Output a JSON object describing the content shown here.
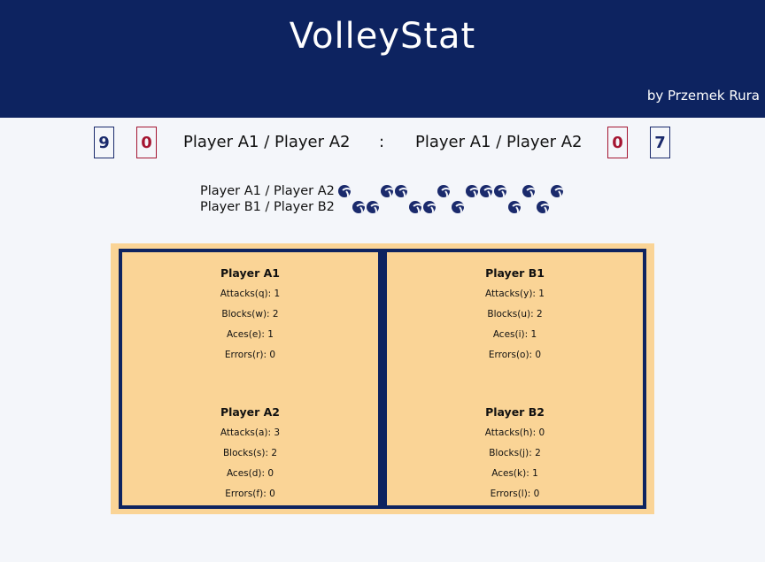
{
  "header": {
    "title": "VolleyStat",
    "byline": "by Przemek Rura"
  },
  "scoreboard": {
    "left": {
      "sets": "9",
      "points": "0",
      "team": "Player A1 / Player A2"
    },
    "separator": ":",
    "right": {
      "team": "Player A1 / Player A2",
      "points": "0",
      "sets": "7"
    }
  },
  "set_history": [
    {
      "team": "Player A1 / Player A2"
    },
    {
      "team": "Player B1 / Player B2"
    }
  ],
  "court": {
    "left_players": [
      {
        "name": "Player A1",
        "stats": [
          "Attacks(q): 1",
          "Blocks(w): 2",
          "Aces(e): 1",
          "Errors(r): 0"
        ]
      },
      {
        "name": "Player A2",
        "stats": [
          "Attacks(a): 3",
          "Blocks(s): 2",
          "Aces(d): 0",
          "Errors(f): 0"
        ]
      }
    ],
    "right_players": [
      {
        "name": "Player B1",
        "stats": [
          "Attacks(y): 1",
          "Blocks(u): 2",
          "Aces(i): 1",
          "Errors(o): 0"
        ]
      },
      {
        "name": "Player B2",
        "stats": [
          "Attacks(h): 0",
          "Blocks(j): 2",
          "Aces(k): 1",
          "Errors(l): 0"
        ]
      }
    ]
  },
  "colors": {
    "navy": "#0d2360",
    "red": "#a51632",
    "court": "#fad496",
    "background": "#f4f6fa"
  },
  "icons": {
    "set_marker": "volleyball-icon"
  }
}
